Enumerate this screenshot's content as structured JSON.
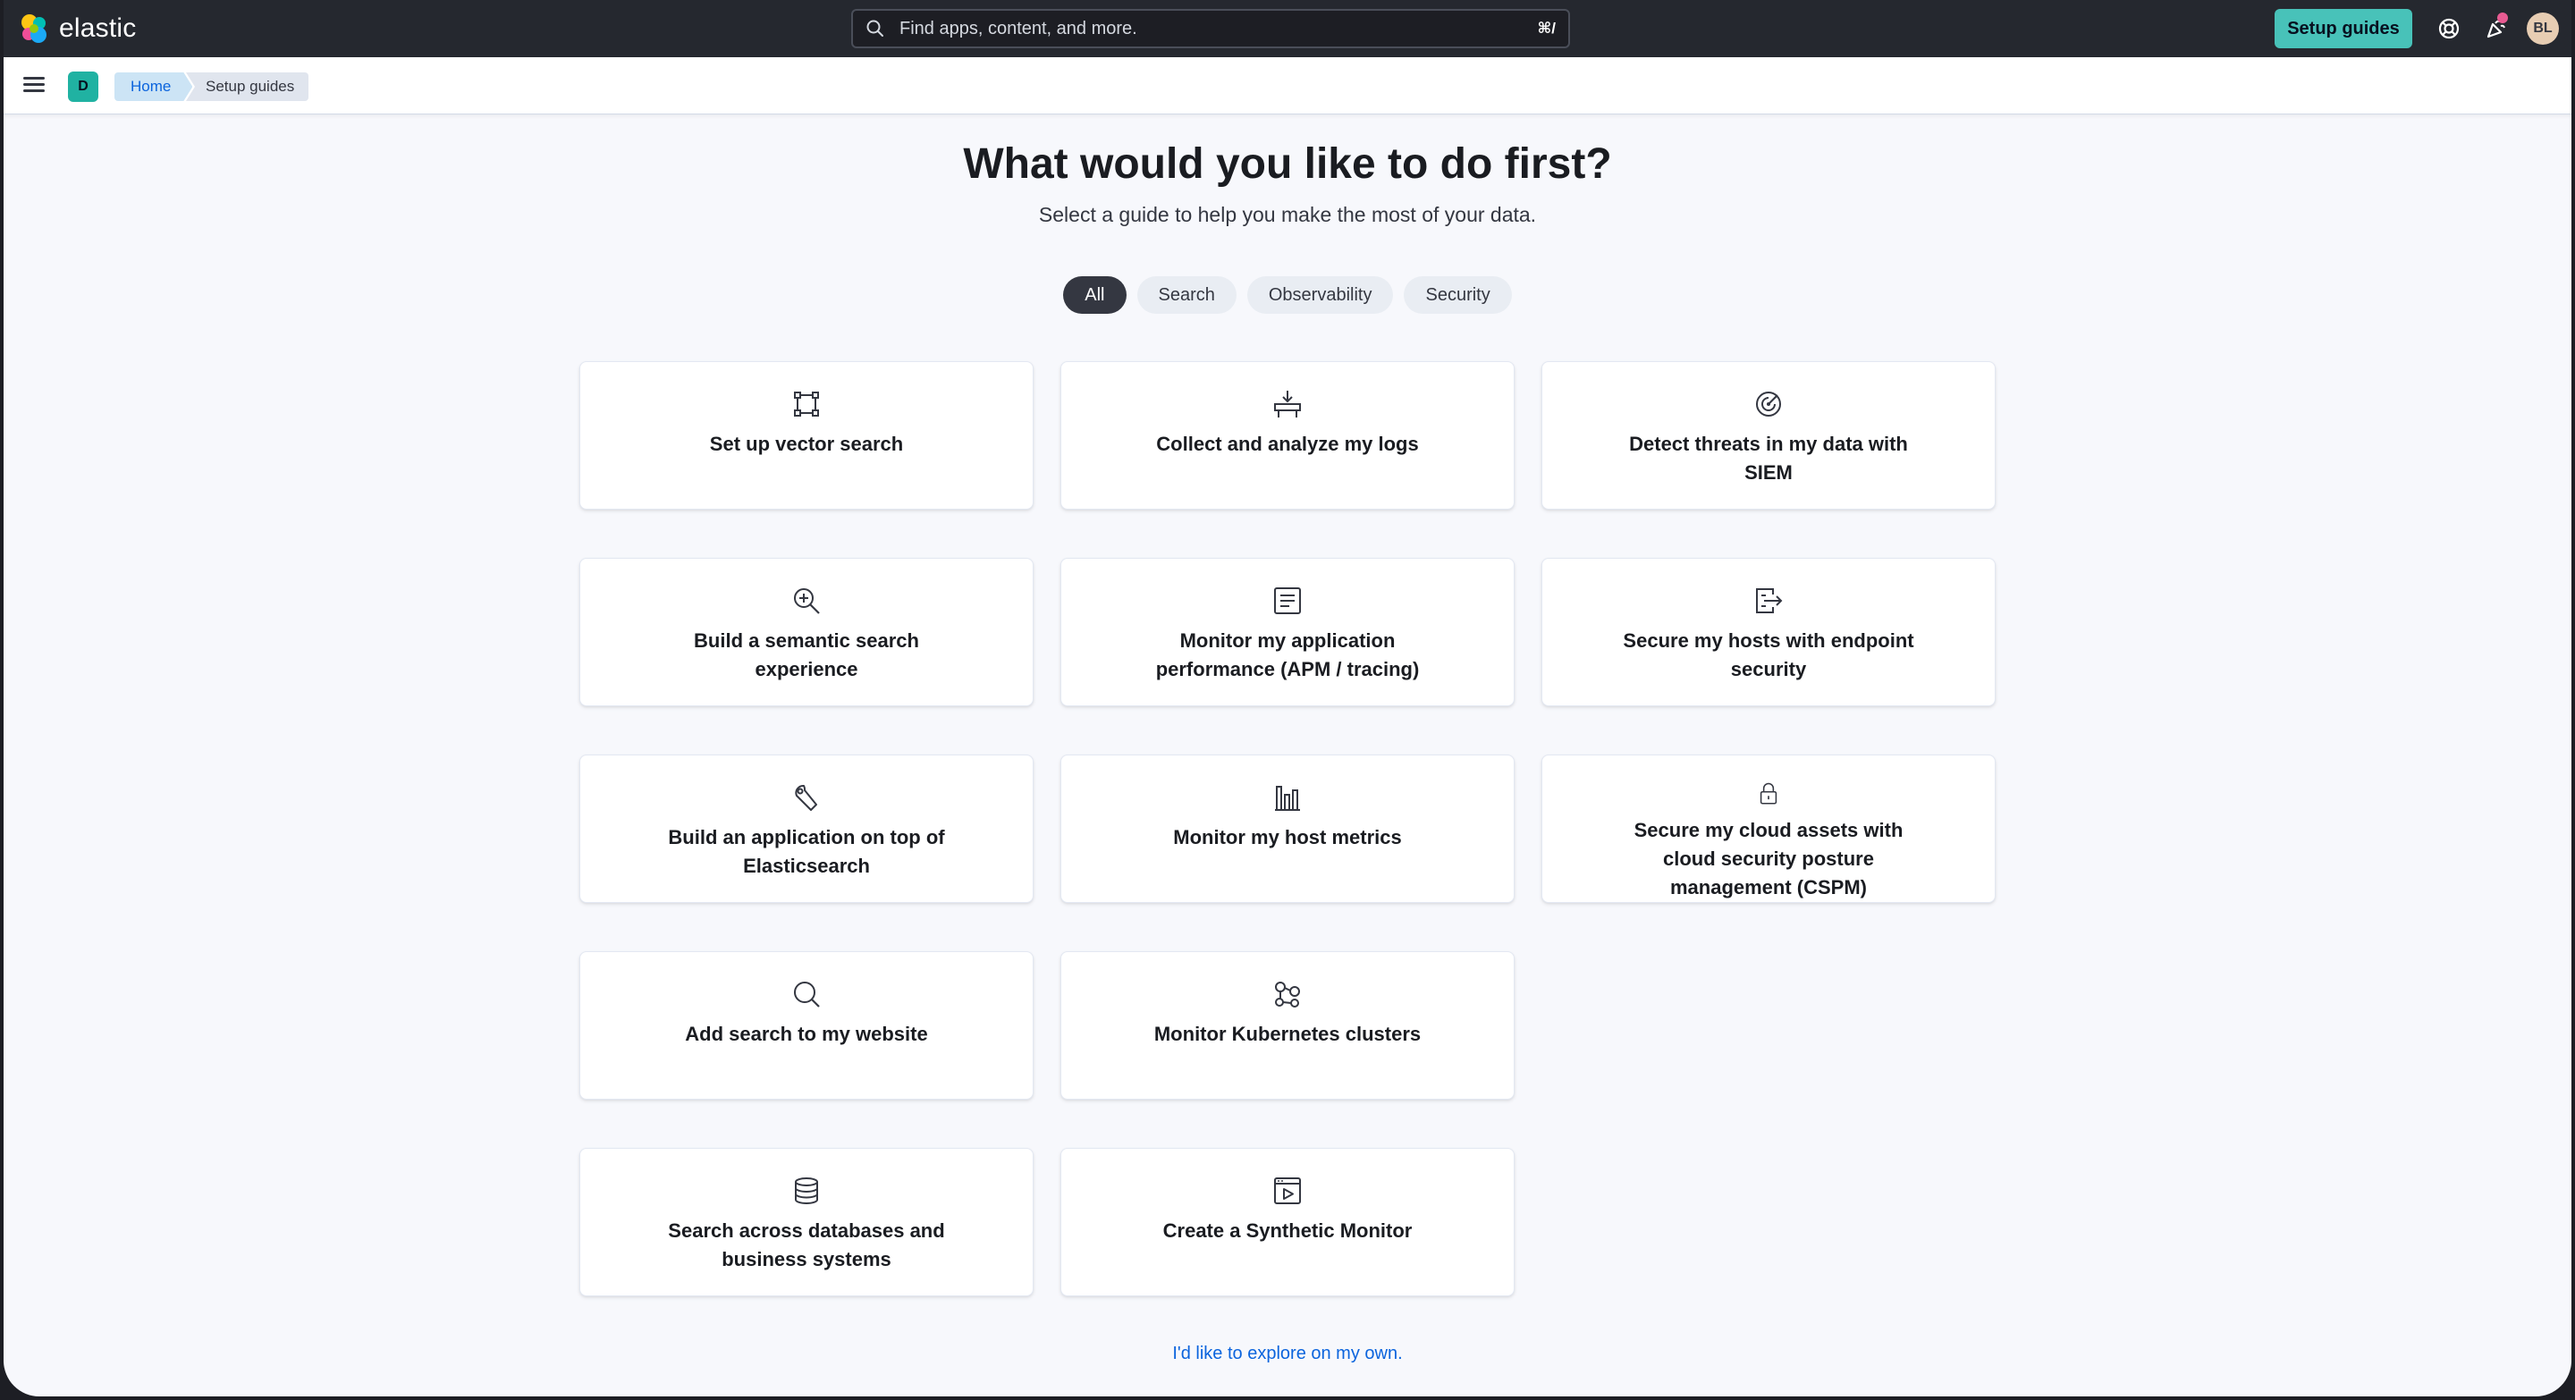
{
  "header": {
    "logo_text": "elastic",
    "search_placeholder": "Find apps, content, and more.",
    "search_shortcut": "⌘/",
    "setup_guides_button": "Setup guides",
    "avatar_initials": "BL"
  },
  "subheader": {
    "space_initial": "D",
    "breadcrumbs": [
      "Home",
      "Setup guides"
    ]
  },
  "main": {
    "title": "What would you like to do first?",
    "subtitle": "Select a guide to help you make the most of your data.",
    "filters": [
      "All",
      "Search",
      "Observability",
      "Security"
    ],
    "active_filter": "All",
    "cards": [
      {
        "label": "Set up vector search",
        "icon": "vector-icon"
      },
      {
        "label": "Collect and analyze my logs",
        "icon": "logs-ingest-icon"
      },
      {
        "label": "Detect threats in my data with SIEM",
        "icon": "radar-icon"
      },
      {
        "label": "Build a semantic search experience",
        "icon": "magnify-plus-icon"
      },
      {
        "label": "Monitor my application performance (APM / tracing)",
        "icon": "document-list-icon"
      },
      {
        "label": "Secure my hosts with endpoint security",
        "icon": "export-icon"
      },
      {
        "label": "Build an application on top of Elasticsearch",
        "icon": "wrench-icon"
      },
      {
        "label": "Monitor my host metrics",
        "icon": "metrics-bars-icon"
      },
      {
        "label": "Secure my cloud assets with cloud security posture management (CSPM)",
        "icon": "lock-icon"
      },
      {
        "label": "Add search to my website",
        "icon": "search-icon"
      },
      {
        "label": "Monitor Kubernetes clusters",
        "icon": "cluster-icon"
      },
      {
        "label": "Search across databases and business systems",
        "icon": "database-icon"
      },
      {
        "label": "Create a Synthetic Monitor",
        "icon": "play-window-icon"
      }
    ],
    "explore_link": "I'd like to explore on my own."
  },
  "colors": {
    "header_bg": "#25282f",
    "accent": "#48c2b9",
    "link": "#0b64dd",
    "page_bg": "#f7f8fc"
  }
}
